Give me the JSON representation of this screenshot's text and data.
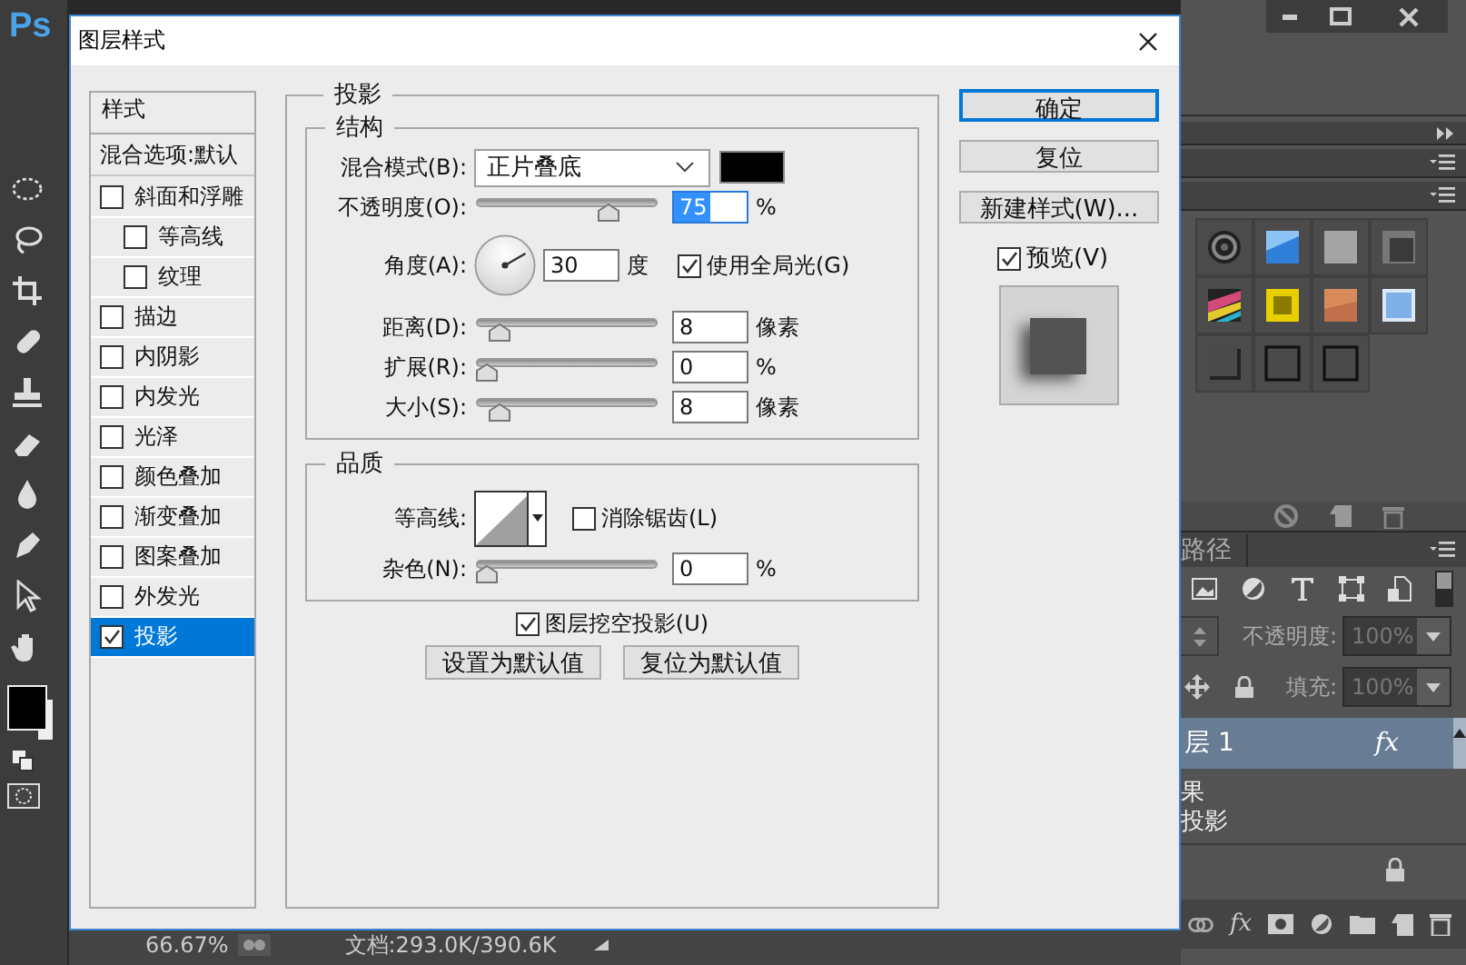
{
  "app": {
    "logo": "Ps"
  },
  "workspace": {
    "zoom": "66.67%",
    "doc_info": "文档:293.0K/390.6K"
  },
  "layers_panel": {
    "tab": "路径",
    "opacity_label": "不透明度:",
    "opacity_value": "100%",
    "fill_label": "填充:",
    "fill_value": "100%",
    "layers": [
      {
        "name": "层 1",
        "selected": true,
        "fx": "fx"
      }
    ],
    "effects": [
      "果",
      "投影"
    ],
    "footer_fx": "fx"
  },
  "dialog": {
    "title": "图层样式",
    "styles": {
      "header": "样式",
      "blending": "混合选项:默认",
      "items": [
        {
          "label": "斜面和浮雕",
          "checked": false,
          "selected": false,
          "children": [
            {
              "label": "等高线",
              "checked": false,
              "selected": false
            },
            {
              "label": "纹理",
              "checked": false,
              "selected": false
            }
          ]
        },
        {
          "label": "描边",
          "checked": false,
          "selected": false
        },
        {
          "label": "内阴影",
          "checked": false,
          "selected": false
        },
        {
          "label": "内发光",
          "checked": false,
          "selected": false
        },
        {
          "label": "光泽",
          "checked": false,
          "selected": false
        },
        {
          "label": "颜色叠加",
          "checked": false,
          "selected": false
        },
        {
          "label": "渐变叠加",
          "checked": false,
          "selected": false
        },
        {
          "label": "图案叠加",
          "checked": false,
          "selected": false
        },
        {
          "label": "外发光",
          "checked": false,
          "selected": false
        },
        {
          "label": "投影",
          "checked": true,
          "selected": true
        }
      ]
    },
    "panel": {
      "title": "投影",
      "structure": {
        "title": "结构",
        "blend_mode": {
          "label": "混合模式(B):",
          "value": "正片叠底",
          "color": "#000000"
        },
        "rows": [
          {
            "kind": "slider",
            "label": "不透明度(O):",
            "level": 0.76,
            "value": "75",
            "unit": "%",
            "focused": true
          },
          {
            "kind": "angle",
            "label": "角度(A):",
            "value": "30",
            "unit": "度",
            "option": {
              "label": "使用全局光(G)",
              "checked": true
            }
          },
          {
            "kind": "slider",
            "label": "距离(D):",
            "level": 0.08,
            "value": "8",
            "unit": "像素",
            "focused": false
          },
          {
            "kind": "slider",
            "label": "扩展(R):",
            "level": 0,
            "value": "0",
            "unit": "%",
            "focused": false
          },
          {
            "kind": "slider",
            "label": "大小(S):",
            "level": 0.08,
            "value": "8",
            "unit": "像素",
            "focused": false
          }
        ]
      },
      "quality": {
        "title": "品质",
        "contour_label": "等高线:",
        "antialias": {
          "label": "消除锯齿(L)",
          "checked": false
        },
        "rows": [
          {
            "kind": "slider",
            "label": "杂色(N):",
            "level": 0,
            "value": "0",
            "unit": "%",
            "focused": false
          }
        ]
      },
      "knockout": {
        "label": "图层挖空投影(U)",
        "checked": true
      },
      "buttons": [
        "设置为默认值",
        "复位为默认值"
      ]
    },
    "actions": [
      {
        "label": "确定",
        "default": true
      },
      {
        "label": "复位",
        "default": false
      },
      {
        "label": "新建样式(W)...",
        "default": false
      }
    ],
    "preview": {
      "label": "预览(V)",
      "checked": true
    }
  }
}
